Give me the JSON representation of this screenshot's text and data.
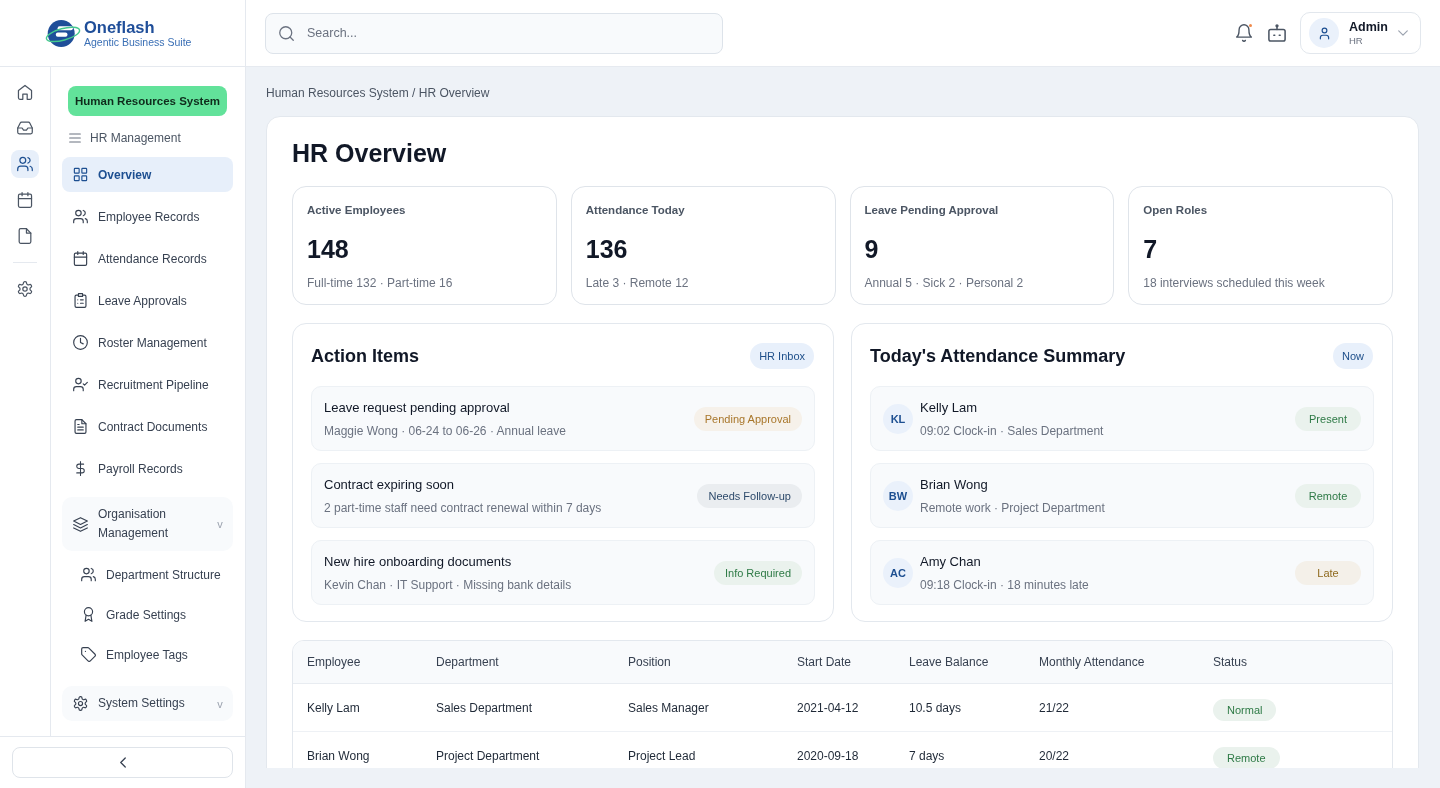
{
  "brand": {
    "name": "Oneflash",
    "tagline": "Agentic Business Suite"
  },
  "rail": {
    "top": [
      {
        "selected": false
      },
      {
        "selected": false
      },
      {
        "selected": true
      },
      {
        "selected": false
      },
      {
        "selected": false
      }
    ],
    "bottom": [
      {
        "selected": false
      }
    ]
  },
  "nav": {
    "system": "Human Resources System",
    "heading": "HR Management",
    "items": [
      {
        "kind": "link",
        "label": "Overview",
        "selected": true
      },
      {
        "kind": "link",
        "label": "Employee Records",
        "selected": false
      },
      {
        "kind": "link",
        "label": "Attendance Records",
        "selected": false
      },
      {
        "kind": "link",
        "label": "Leave Approvals",
        "selected": false
      },
      {
        "kind": "link",
        "label": "Roster Management",
        "selected": false
      },
      {
        "kind": "link",
        "label": "Recruitment Pipeline",
        "selected": false
      },
      {
        "kind": "link",
        "label": "Contract Documents",
        "selected": false
      },
      {
        "kind": "link",
        "label": "Payroll Records",
        "selected": false
      },
      {
        "kind": "group",
        "label": "Organisation Management",
        "toggle": "v",
        "children": [
          {
            "label": "Department Structure",
            "selected": false
          },
          {
            "label": "Grade Settings",
            "selected": false
          },
          {
            "label": "Employee Tags",
            "selected": false
          }
        ]
      },
      {
        "kind": "group",
        "label": "System Settings",
        "toggle": "v"
      }
    ]
  },
  "header": {
    "search": {
      "placeholder": "Search..."
    },
    "notifications": {
      "unread": true
    },
    "user": {
      "name": "Admin",
      "role": "HR"
    }
  },
  "breadcrumb": "Human Resources System / HR Overview",
  "page_title": "HR Overview",
  "stats": [
    {
      "label": "Active Employees",
      "value": "148",
      "detail": "Full-time 132 · Part-time 16"
    },
    {
      "label": "Attendance Today",
      "value": "136",
      "detail": "Late 3 · Remote 12"
    },
    {
      "label": "Leave Pending Approval",
      "value": "9",
      "detail": "Annual 5 · Sick 2 · Personal 2"
    },
    {
      "label": "Open Roles",
      "value": "7",
      "detail": "18 interviews scheduled this week"
    }
  ],
  "action_items": {
    "title": "Action Items",
    "tag": "HR Inbox",
    "items": [
      {
        "title": "Leave request pending approval",
        "detail": "Maggie Wong · 06-24 to 06-26 · Annual leave",
        "status": "Pending Approval",
        "color": "#a8762a"
      },
      {
        "title": "Contract expiring soon",
        "detail": "2 part-time staff need contract renewal within 7 days",
        "status": "Needs Follow-up",
        "color": "#2d4a6b"
      },
      {
        "title": "New hire onboarding documents",
        "detail": "Kevin Chan · IT Support · Missing bank details",
        "status": "Info Required",
        "color": "#2e7a46"
      }
    ]
  },
  "attendance_summary": {
    "title": "Today's Attendance Summary",
    "tag": "Now",
    "items": [
      {
        "initials": "KL",
        "name": "Kelly Lam",
        "detail": "09:02 Clock-in · Sales Department",
        "status": "Present",
        "color": "#2e7a46"
      },
      {
        "initials": "BW",
        "name": "Brian Wong",
        "detail": "Remote work · Project Department",
        "status": "Remote",
        "color": "#2e7a46"
      },
      {
        "initials": "AC",
        "name": "Amy Chan",
        "detail": "09:18 Clock-in · 18 minutes late",
        "status": "Late",
        "color": "#8f6a1e"
      }
    ]
  },
  "table": {
    "columns": [
      "Employee",
      "Department",
      "Position",
      "Start Date",
      "Leave Balance",
      "Monthly Attendance",
      "Status"
    ],
    "rows": [
      {
        "cells": [
          "Kelly Lam",
          "Sales Department",
          "Sales Manager",
          "2021-04-12",
          "10.5 days",
          "21/22"
        ],
        "status": {
          "label": "Normal",
          "color": "#2e7a46"
        }
      },
      {
        "cells": [
          "Brian Wong",
          "Project Department",
          "Project Lead",
          "2020-09-18",
          "7 days",
          "20/22"
        ],
        "status": {
          "label": "Remote",
          "color": "#2e7a46"
        }
      }
    ]
  }
}
